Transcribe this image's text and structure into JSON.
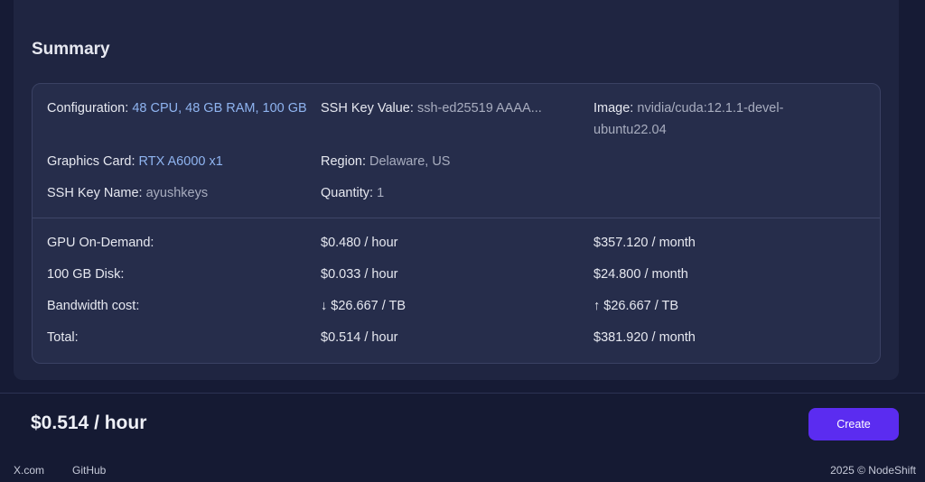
{
  "summary": {
    "title": "Summary",
    "configuration": {
      "label": "Configuration:",
      "value": "48 CPU, 48 GB RAM, 100 GB"
    },
    "ssh_key_value": {
      "label": "SSH Key Value:",
      "value": "ssh-ed25519 AAAA..."
    },
    "image": {
      "label": "Image:",
      "value": "nvidia/cuda:12.1.1-devel-ubuntu22.04"
    },
    "graphics_card": {
      "label": "Graphics Card:",
      "value": "RTX A6000 x1"
    },
    "region": {
      "label": "Region:",
      "value": "Delaware, US"
    },
    "ssh_key_name": {
      "label": "SSH Key Name:",
      "value": "ayushkeys"
    },
    "quantity": {
      "label": "Quantity:",
      "value": "1"
    },
    "costs": [
      {
        "label": "GPU On-Demand:",
        "hourly": "$0.480 / hour",
        "monthly": "$357.120 / month"
      },
      {
        "label": "100 GB Disk:",
        "hourly": "$0.033 / hour",
        "monthly": "$24.800 / month"
      },
      {
        "label": "Bandwidth cost:",
        "hourly": "↓ $26.667 / TB",
        "monthly": "↑ $26.667 / TB"
      },
      {
        "label": "Total:",
        "hourly": "$0.514 / hour",
        "monthly": "$381.920 / month"
      }
    ]
  },
  "footer": {
    "price": "$0.514 / hour",
    "create_label": "Create",
    "links": [
      "X.com",
      "GitHub"
    ],
    "copyright": "2025 © NodeShift"
  },
  "colors": {
    "accent": "#5b2cf0",
    "value_blue": "#8fb4f0",
    "background": "#161b35"
  }
}
